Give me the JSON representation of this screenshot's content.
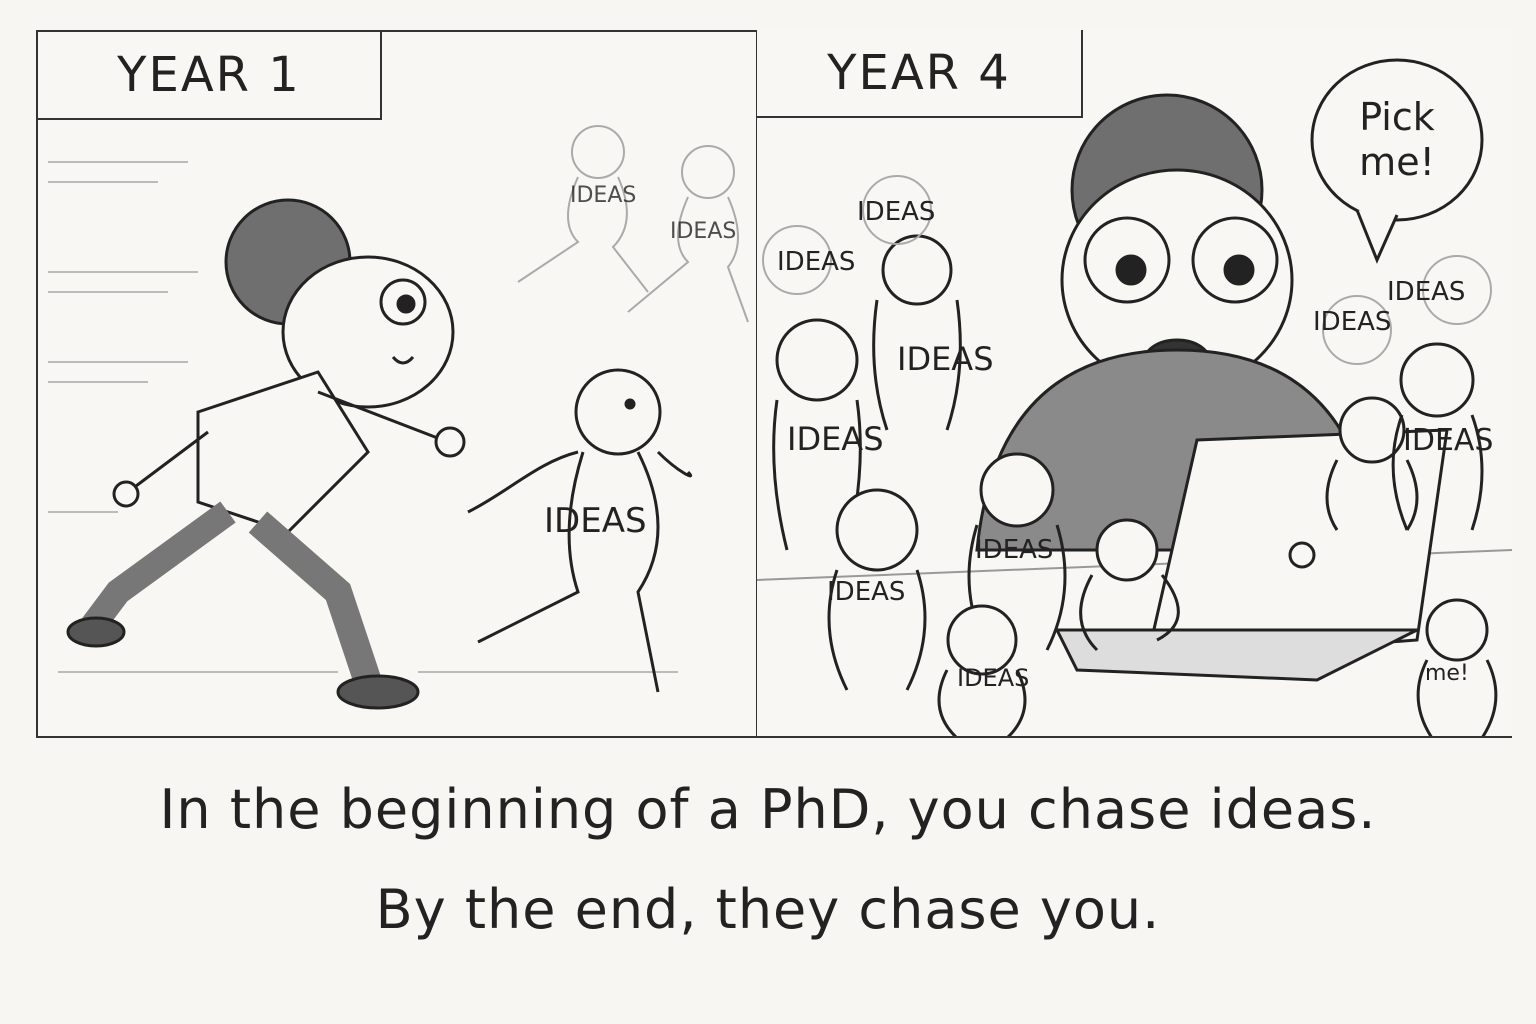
{
  "panels": [
    {
      "label": "YEAR 1",
      "figures": [
        "IDEAS",
        "IDEAS",
        "IDEAS"
      ]
    },
    {
      "label": "YEAR 4",
      "speech_bubble": "Pick me!",
      "figures": [
        "IDEAS",
        "IDEAS",
        "IDEAS",
        "IDEAS",
        "IDEAS",
        "IDEAS",
        "IDEAS",
        "IDEAS",
        "IDEAS",
        "IDEAS",
        "me!"
      ]
    }
  ],
  "caption": {
    "line1": "In the beginning of a PhD, you chase ideas.",
    "line2": "By the end, they chase you."
  },
  "colors": {
    "ink": "#222222",
    "paper": "#f7f6f2",
    "shading": "#8a8a8a"
  }
}
